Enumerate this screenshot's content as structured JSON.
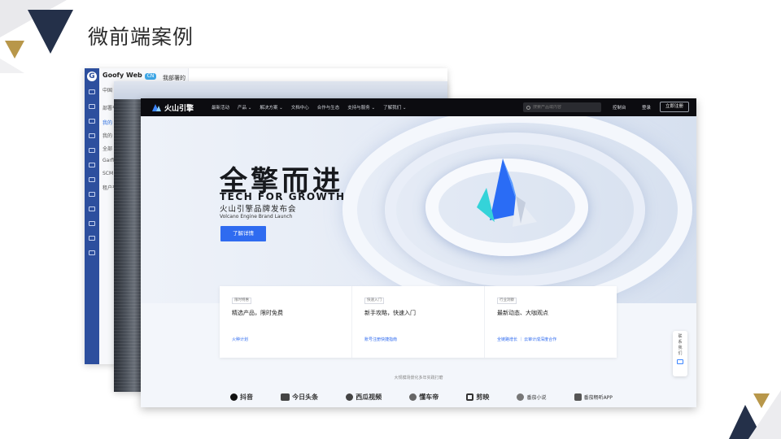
{
  "slide": {
    "title": "微前端案例"
  },
  "back_window": {
    "brand": "Goofy Web",
    "badge": "CN",
    "header": "我部署的",
    "side_items": [
      "中国",
      "部署平",
      "我的",
      "我的",
      "全部",
      "Garfi",
      "SCM",
      "租户平"
    ]
  },
  "volcano": {
    "logo_text": "火山引擎",
    "nav_items": [
      "最新活动",
      "产品 ⌄",
      "解决方案 ⌄",
      "文档中心",
      "合作与生态",
      "支持与服务 ⌄",
      "了解我们 ⌄"
    ],
    "search_placeholder": "搜索产品或内容",
    "console": "控制台",
    "login": "登录",
    "register": "立即注册",
    "hero": {
      "title": "全擎而进",
      "subtitle": "TECH FOR GROWTH",
      "cn_line": "火山引擎品牌发布会",
      "en_line": "Volcano Engine Brand Launch",
      "button": "了解详情"
    },
    "cards": [
      {
        "tag": "限时特惠",
        "title": "精选产品，限时免费",
        "link": "火种计划"
      },
      {
        "tag": "快速入门",
        "title": "新手攻略，快速入门",
        "link": "账号注册快捷指南"
      },
      {
        "tag": "行业洞察",
        "title": "最新动态、大咖观点",
        "link": "全链路增长 ｜ 云审计成深度合作"
      }
    ],
    "partners_label": "大规模场景化多年实践打磨",
    "partners": [
      "抖音",
      "今日头条",
      "西瓜视频",
      "懂车帝",
      "剪映",
      "番茄小说",
      "番茄畅听APP"
    ],
    "contact": [
      "联",
      "系",
      "我",
      "们"
    ]
  },
  "colors": {
    "accent_blue": "#2f6bf0",
    "nav_bg": "#0c0c10",
    "rail_blue": "#2d4f9e",
    "deco_navy": "#243049",
    "deco_gold": "#b8974a"
  }
}
